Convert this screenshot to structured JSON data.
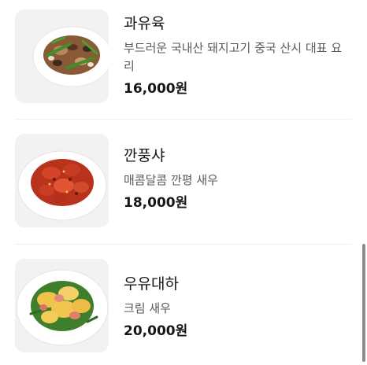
{
  "menu": {
    "items": [
      {
        "name": "과유육",
        "description": "부드러운 국내산 돼지고기 중국 산시 대표 요리",
        "price": "16,000원"
      },
      {
        "name": "깐풍샤",
        "description": "매콤달콤 깐평 새우",
        "price": "18,000원"
      },
      {
        "name": "우유대하",
        "description": "크림 새우",
        "price": "20,000원"
      }
    ]
  },
  "colors": {
    "text_primary": "#161616",
    "text_secondary": "#5a5a5a",
    "thumb_background": "#f3f3f3",
    "divider": "#efefef",
    "scrollbar": "#8c8c8c"
  }
}
